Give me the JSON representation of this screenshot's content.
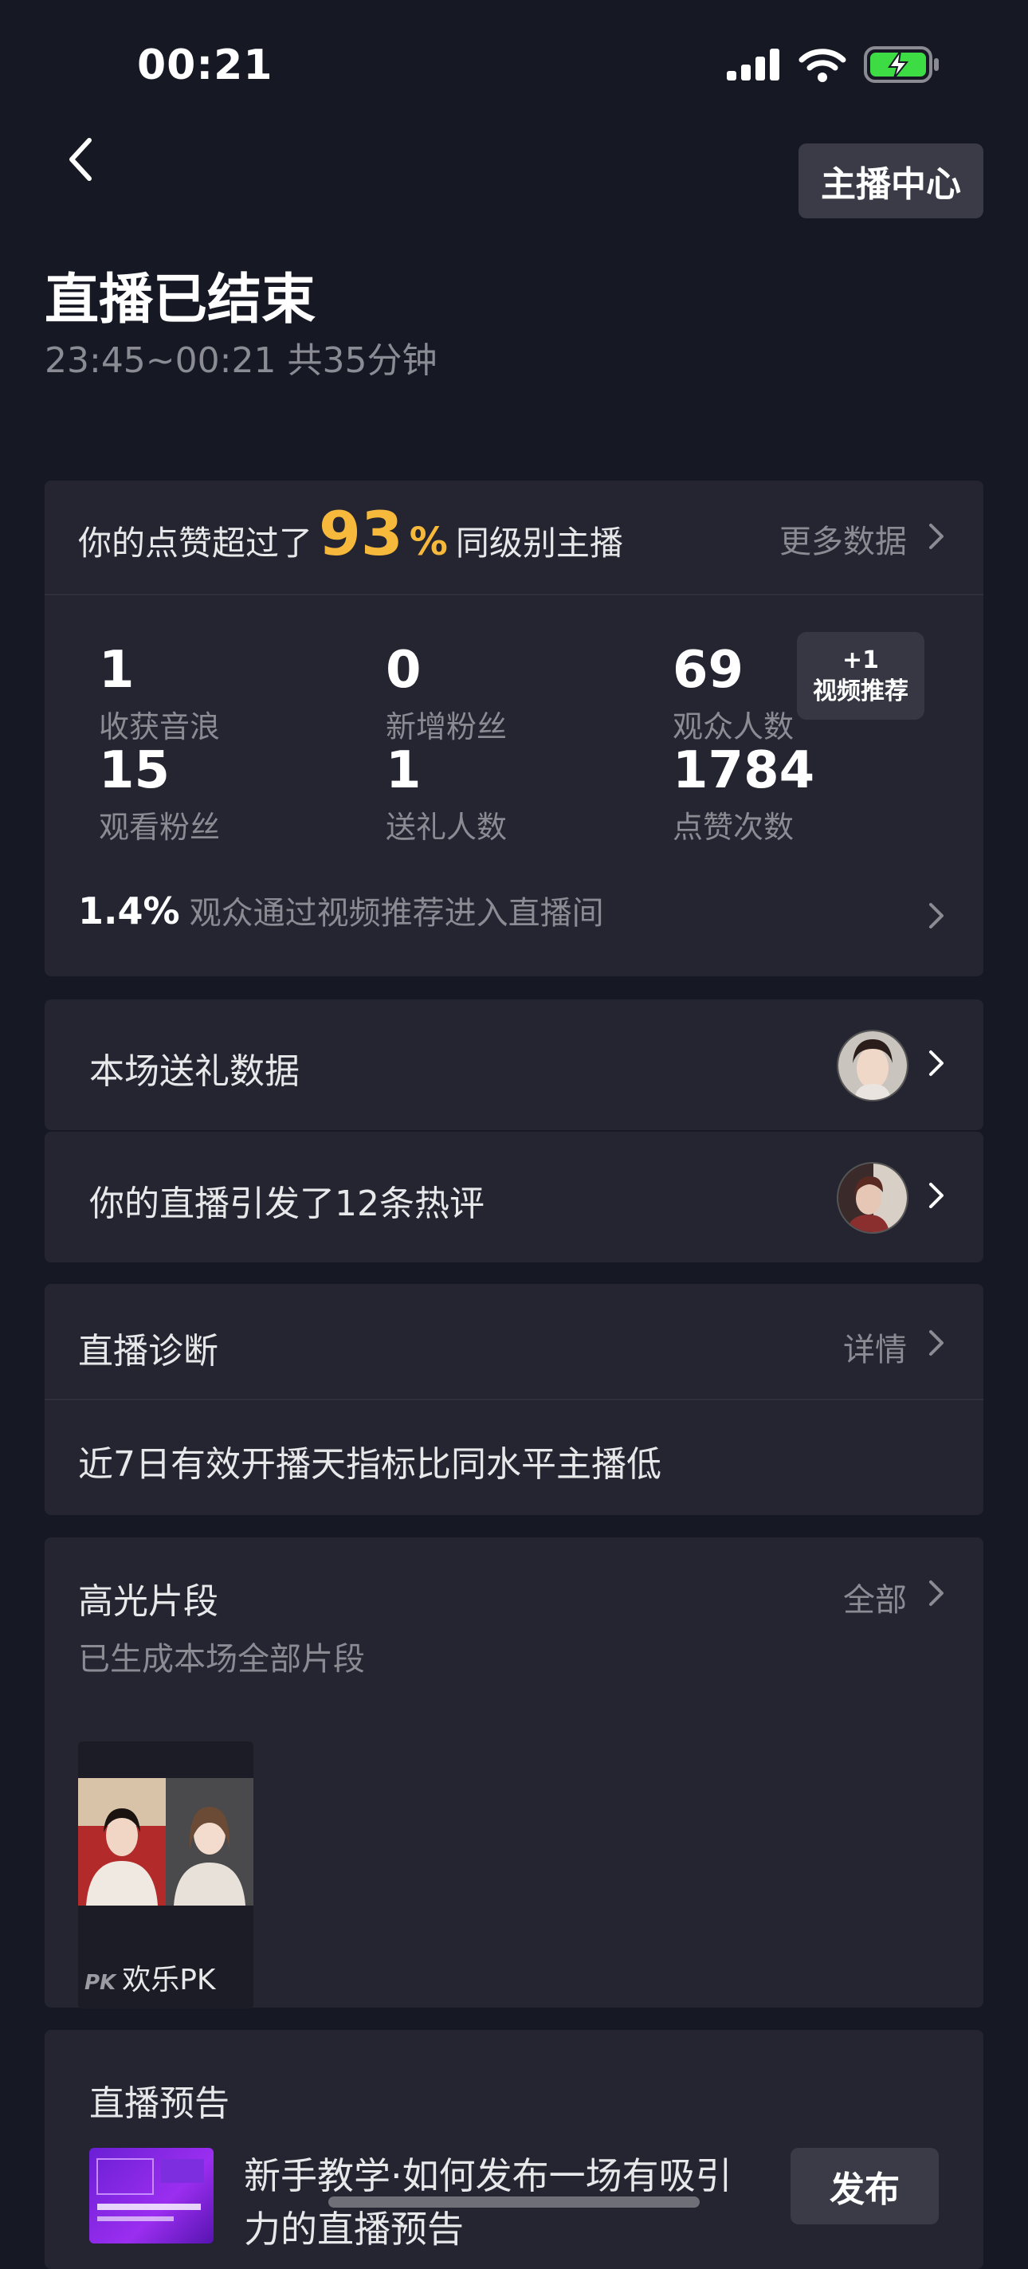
{
  "status_bar": {
    "time": "00:21"
  },
  "header": {
    "center_button": "主播中心"
  },
  "title": "直播已结束",
  "subtitle": "23:45~00:21 共35分钟",
  "stats_card": {
    "likes_prefix": "你的点赞超过了",
    "likes_percent": "93",
    "likes_percent_sign": "%",
    "likes_suffix": "同级别主播",
    "more_data": "更多数据",
    "stats": [
      {
        "value": "1",
        "label": "收获音浪"
      },
      {
        "value": "0",
        "label": "新增粉丝"
      },
      {
        "value": "69",
        "label": "观众人数"
      },
      {
        "value": "15",
        "label": "观看粉丝"
      },
      {
        "value": "1",
        "label": "送礼人数"
      },
      {
        "value": "1784",
        "label": "点赞次数"
      }
    ],
    "rec_badge": {
      "line1": "+1",
      "line2": "视频推荐"
    },
    "rec_percent": "1.4%",
    "rec_text": "观众通过视频推荐进入直播间"
  },
  "gift_rows": [
    {
      "label": "本场送礼数据"
    },
    {
      "label": "你的直播引发了12条热评"
    }
  ],
  "diagnosis": {
    "title": "直播诊断",
    "detail": "详情",
    "text": "近7日有效开播天指标比同水平主播低"
  },
  "highlights": {
    "title": "高光片段",
    "all": "全部",
    "sub": "已生成本场全部片段",
    "clip_icon": "PK",
    "clip_label": "欢乐PK"
  },
  "preview": {
    "title": "直播预告",
    "text": "新手教学·如何发布一场有吸引力的直播预告",
    "publish": "发布"
  },
  "icons": {
    "back": "chevron-left-icon",
    "signal": "signal-icon",
    "wifi": "wifi-icon",
    "battery": "battery-charging-icon"
  },
  "colors": {
    "background": "#161823",
    "card": "#242530",
    "accent": "#f6b93b",
    "battery": "#3ddc45"
  }
}
